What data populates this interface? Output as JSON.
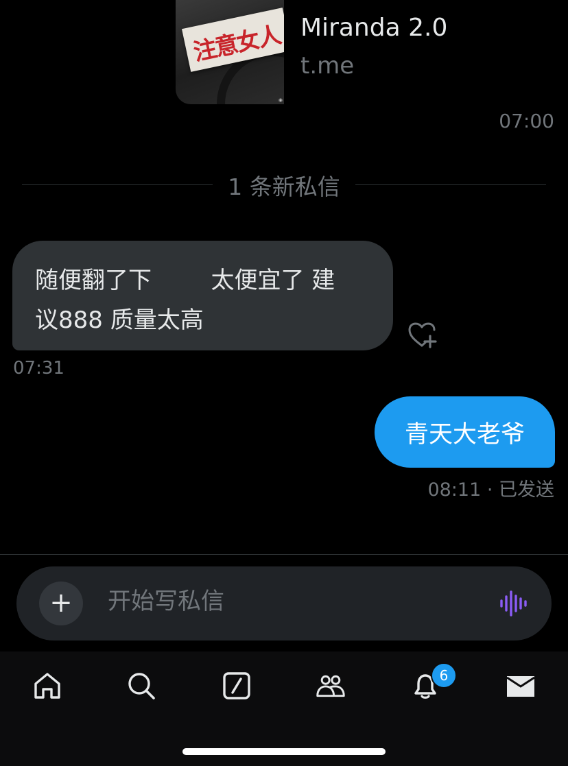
{
  "link_preview": {
    "thumbnail_text": "注意女人",
    "title": "Miranda 2.0",
    "domain": "t.me",
    "time": "07:00"
  },
  "new_messages_divider": "1 条新私信",
  "received_message": {
    "line1": "随便翻了下        太便宜了 建",
    "line2": "议888 质量太高",
    "time": "07:31",
    "react_icon": "heart-plus-icon"
  },
  "sent_message": {
    "text": "青天大老爷",
    "status": "08:11 · 已发送"
  },
  "composer": {
    "placeholder": "开始写私信",
    "add_icon": "plus-icon",
    "voice_icon": "voice-wave-icon"
  },
  "tabbar": {
    "items": [
      "home-icon",
      "search-icon",
      "grok-icon",
      "communities-icon",
      "notifications-icon",
      "messages-icon"
    ],
    "notifications_badge": "6"
  },
  "colors": {
    "background": "#000000",
    "accent": "#1d9bf0",
    "received_bubble": "#2f3336",
    "muted_text": "#71767b",
    "voice_icon": "#8b5cf6"
  }
}
